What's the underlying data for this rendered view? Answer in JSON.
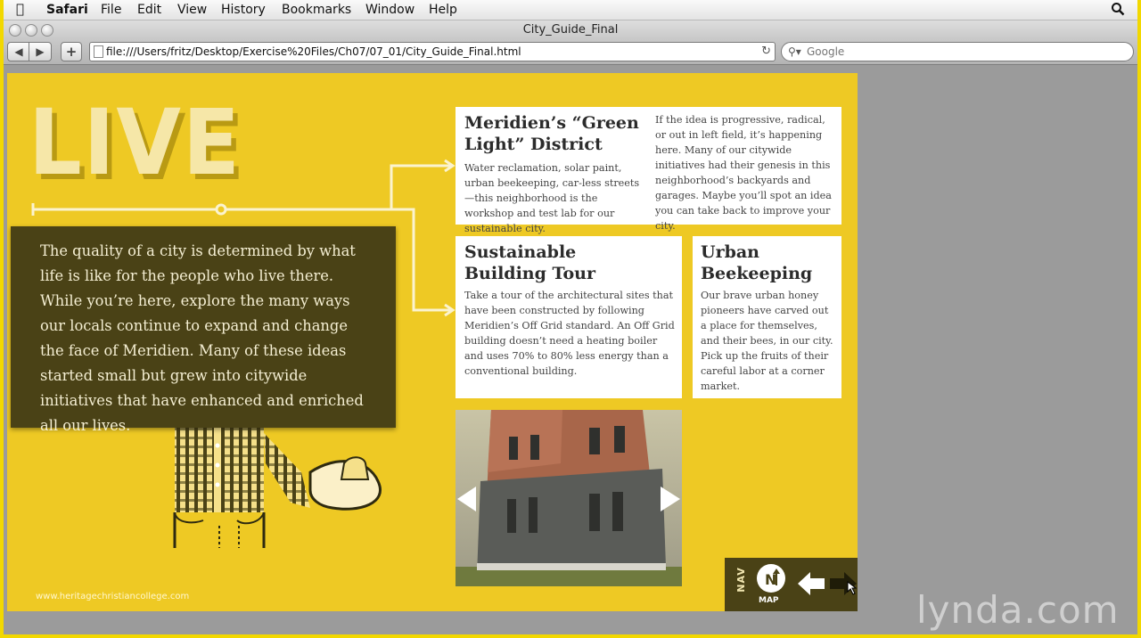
{
  "menubar": {
    "app": "Safari",
    "items": [
      "File",
      "Edit",
      "View",
      "History",
      "Bookmarks",
      "Window",
      "Help"
    ]
  },
  "window": {
    "title": "City_Guide_Final"
  },
  "toolbar": {
    "back": "◀",
    "forward": "▶",
    "add": "+",
    "url": "file:///Users/fritz/Desktop/Exercise%20Files/Ch07/07_01/City_Guide_Final.html",
    "search_placeholder": "Google"
  },
  "page": {
    "hero_title": "LIVE",
    "intro": "The quality of a city is determined by what life is like for the people who live there. While you’re here, explore the many ways our locals continue to expand and change the face of Meridien. Many of these ideas started small but grew into citywide initiatives that  have enhanced and enriched all our lives.",
    "cards": [
      {
        "title": "Meridien’s “Green Light” District",
        "body": "Water reclamation, solar paint, urban beekeeping, car-less streets—this neighborhood is the workshop and test lab for our sustainable city.",
        "body2": "If the idea is progressive, radical, or out in left field, it’s happening here. Many of our citywide initiatives had their genesis in this neighborhood’s backyards and garages. Maybe you’ll spot an idea you can take back to improve your city."
      },
      {
        "title": "Sustainable Building Tour",
        "body": "Take a tour of the architectural sites that have been constructed by following Meridien’s Off Grid standard. An Off Grid building doesn’t need a heating boiler and uses 70% to 80% less energy than a conventional building."
      },
      {
        "title": "Urban Beekeeping",
        "body": "Our brave urban honey pioneers have carved out a place for themselves, and their bees, in our city. Pick up the fruits of their careful labor at a corner market."
      }
    ],
    "nav": {
      "label": "NAV",
      "map_icon_letter": "N",
      "map_label": "MAP"
    }
  },
  "overlay": {
    "watermark": "www.heritagechristiancollege.com",
    "brand": "lynda.com"
  },
  "colors": {
    "page_bg": "#eec924",
    "dark_panel": "#4a4216",
    "frame": "#f2d800"
  }
}
